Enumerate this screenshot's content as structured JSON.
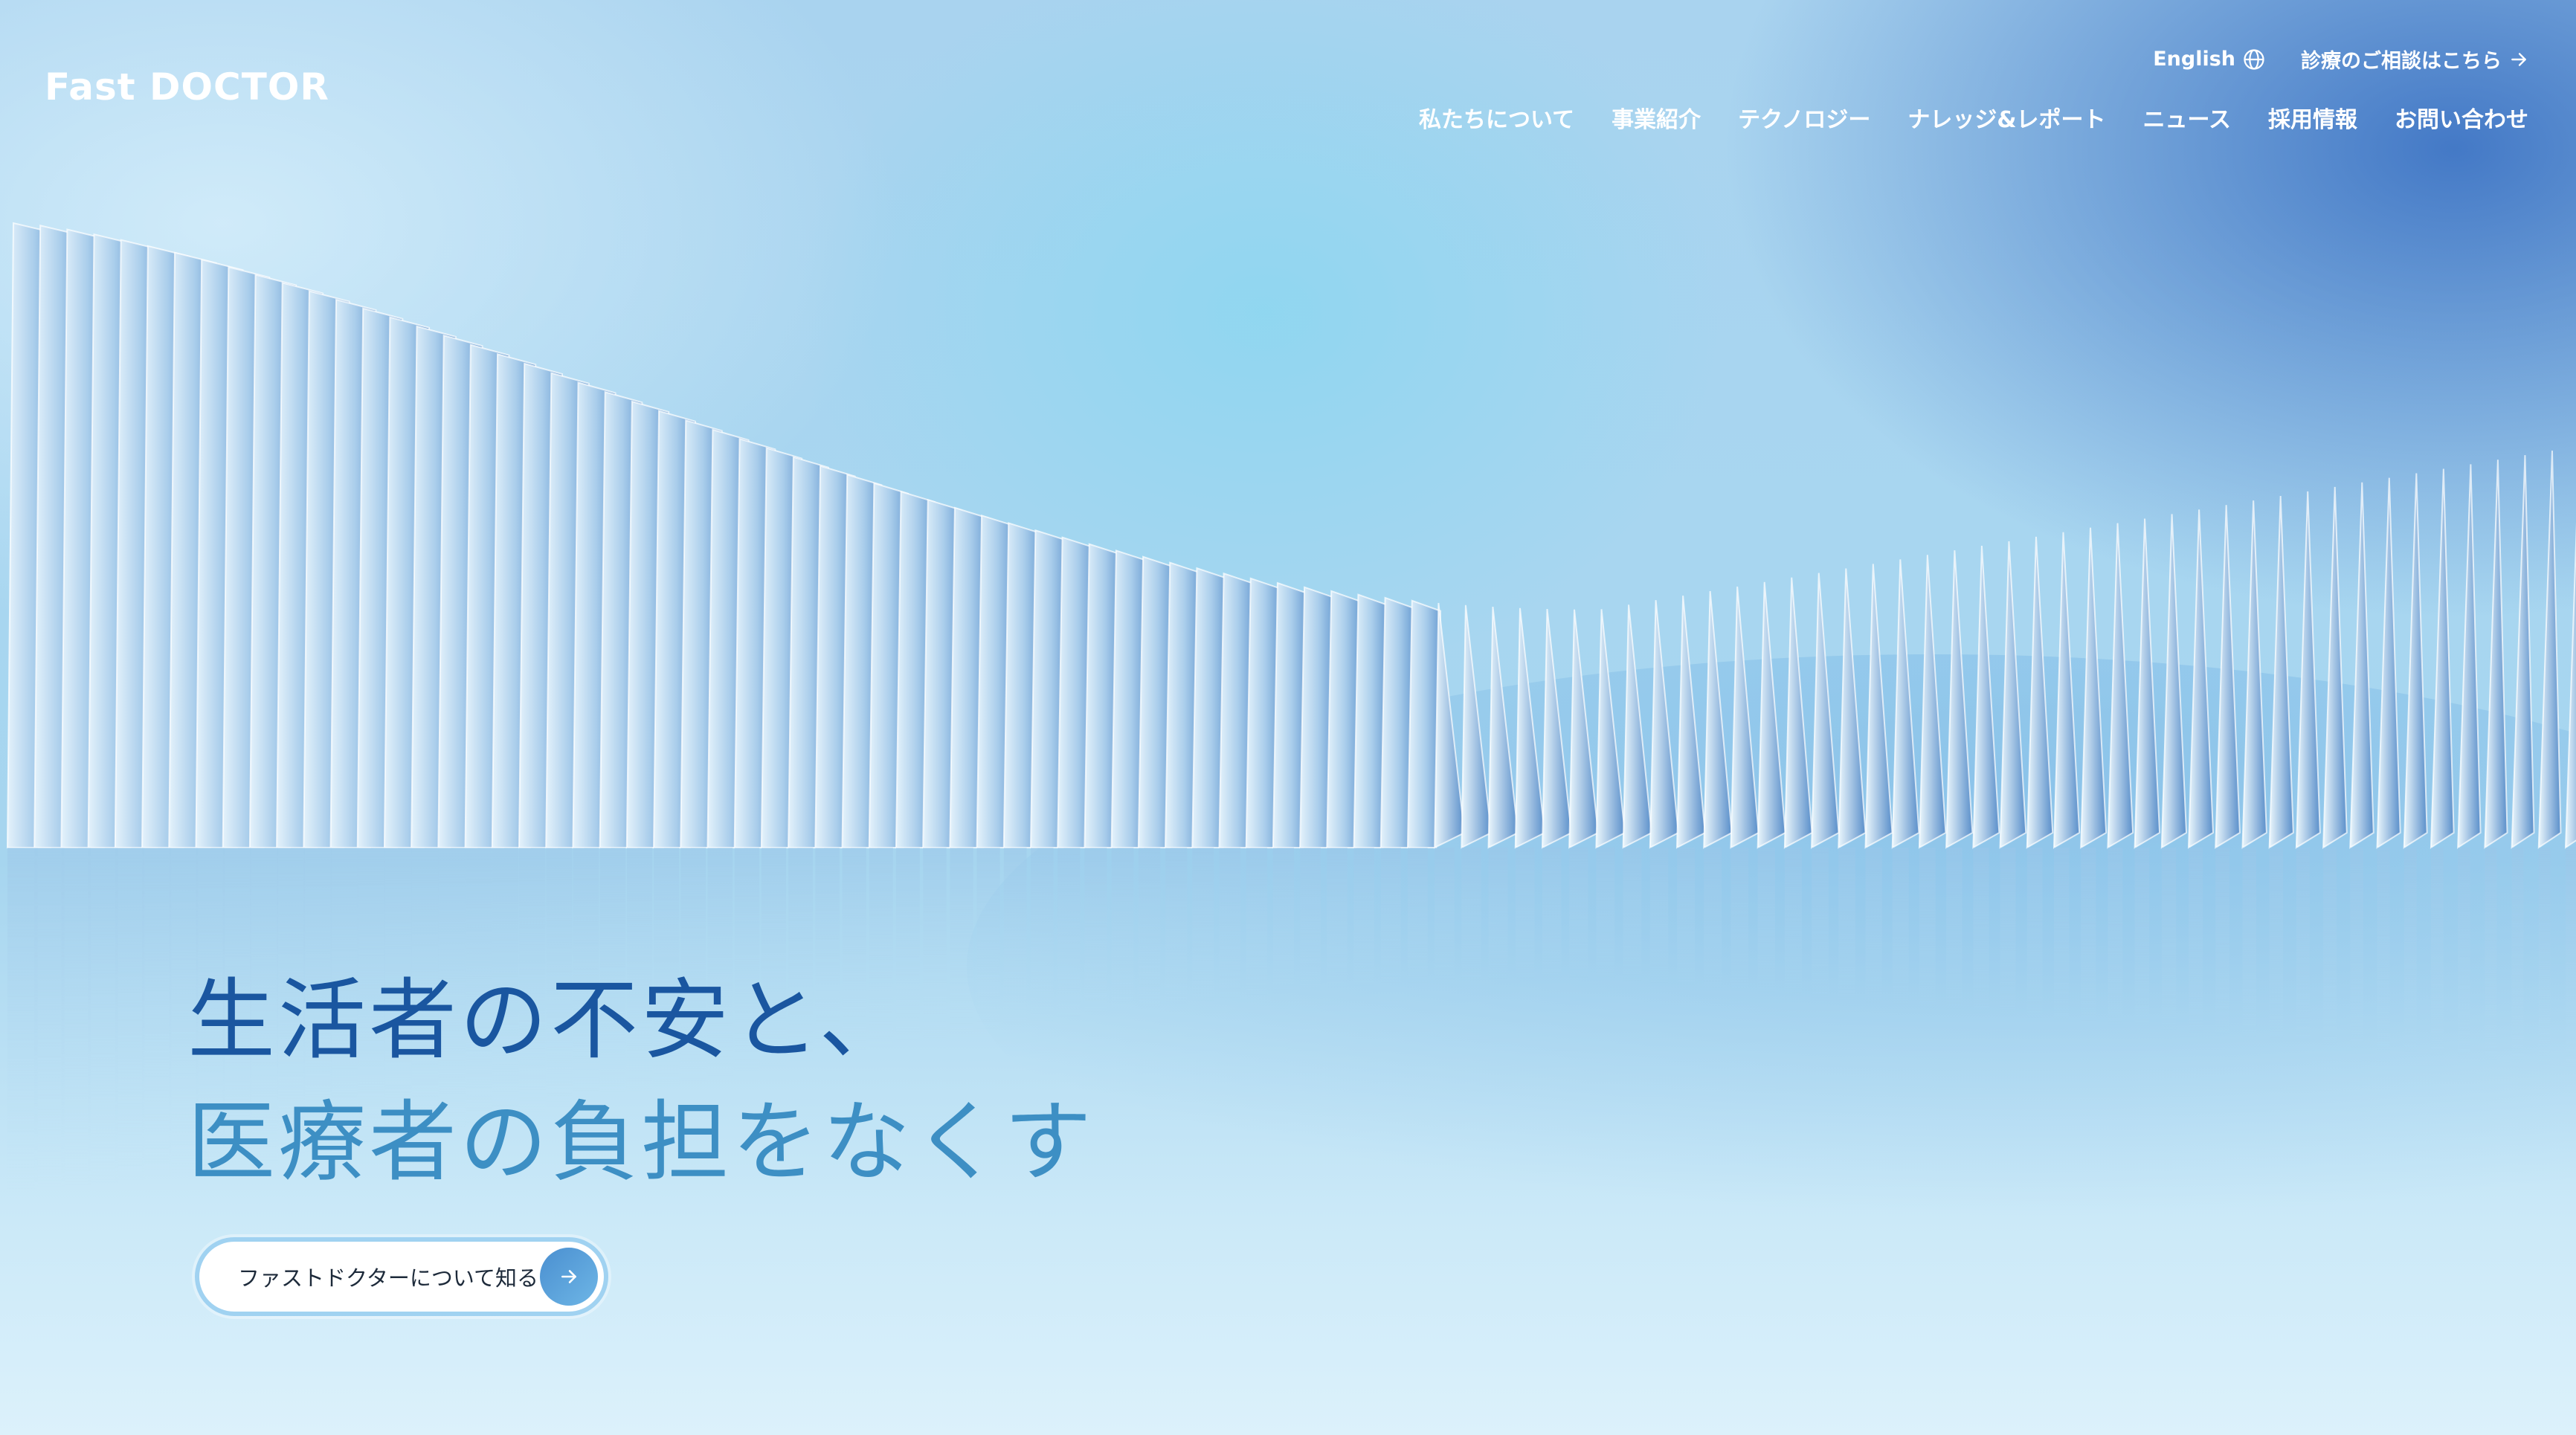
{
  "header": {
    "logo": "Fast DOCTOR",
    "util": {
      "language_label": "English",
      "language_icon": "globe-icon",
      "consult_label": "診療のご相談はこちら",
      "consult_icon": "arrow-right-icon"
    },
    "nav": [
      {
        "label": "私たちについて"
      },
      {
        "label": "事業紹介"
      },
      {
        "label": "テクノロジー"
      },
      {
        "label": "ナレッジ&レポート"
      },
      {
        "label": "ニュース"
      },
      {
        "label": "採用情報"
      },
      {
        "label": "お問い合わせ"
      }
    ]
  },
  "hero": {
    "line1": "生活者の不安と、",
    "line2": "医療者の負担をなくす",
    "cta_label": "ファストドクターについて知る",
    "cta_icon": "arrow-right-icon",
    "colors": {
      "line1": "#1a56a0",
      "line2": "#3d8fc4",
      "cta_accent": "#4a8fd0"
    }
  }
}
